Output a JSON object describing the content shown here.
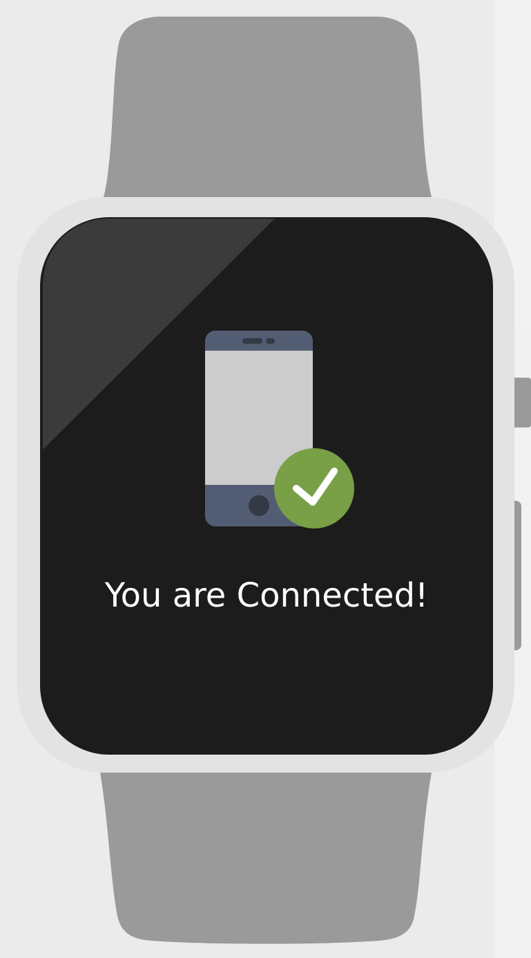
{
  "screen": {
    "status_message": "You are Connected!"
  },
  "icons": {
    "device": "smartphone-icon",
    "status": "checkmark-icon"
  },
  "colors": {
    "background": "#ebebeb",
    "band": "#9a9a9a",
    "case": "#e3e3e3",
    "screen": "#1c1c1c",
    "phone_frame": "#525d73",
    "phone_screen": "#cccccc",
    "phone_details": "#343a45",
    "success": "#79a046",
    "text": "#ffffff"
  }
}
